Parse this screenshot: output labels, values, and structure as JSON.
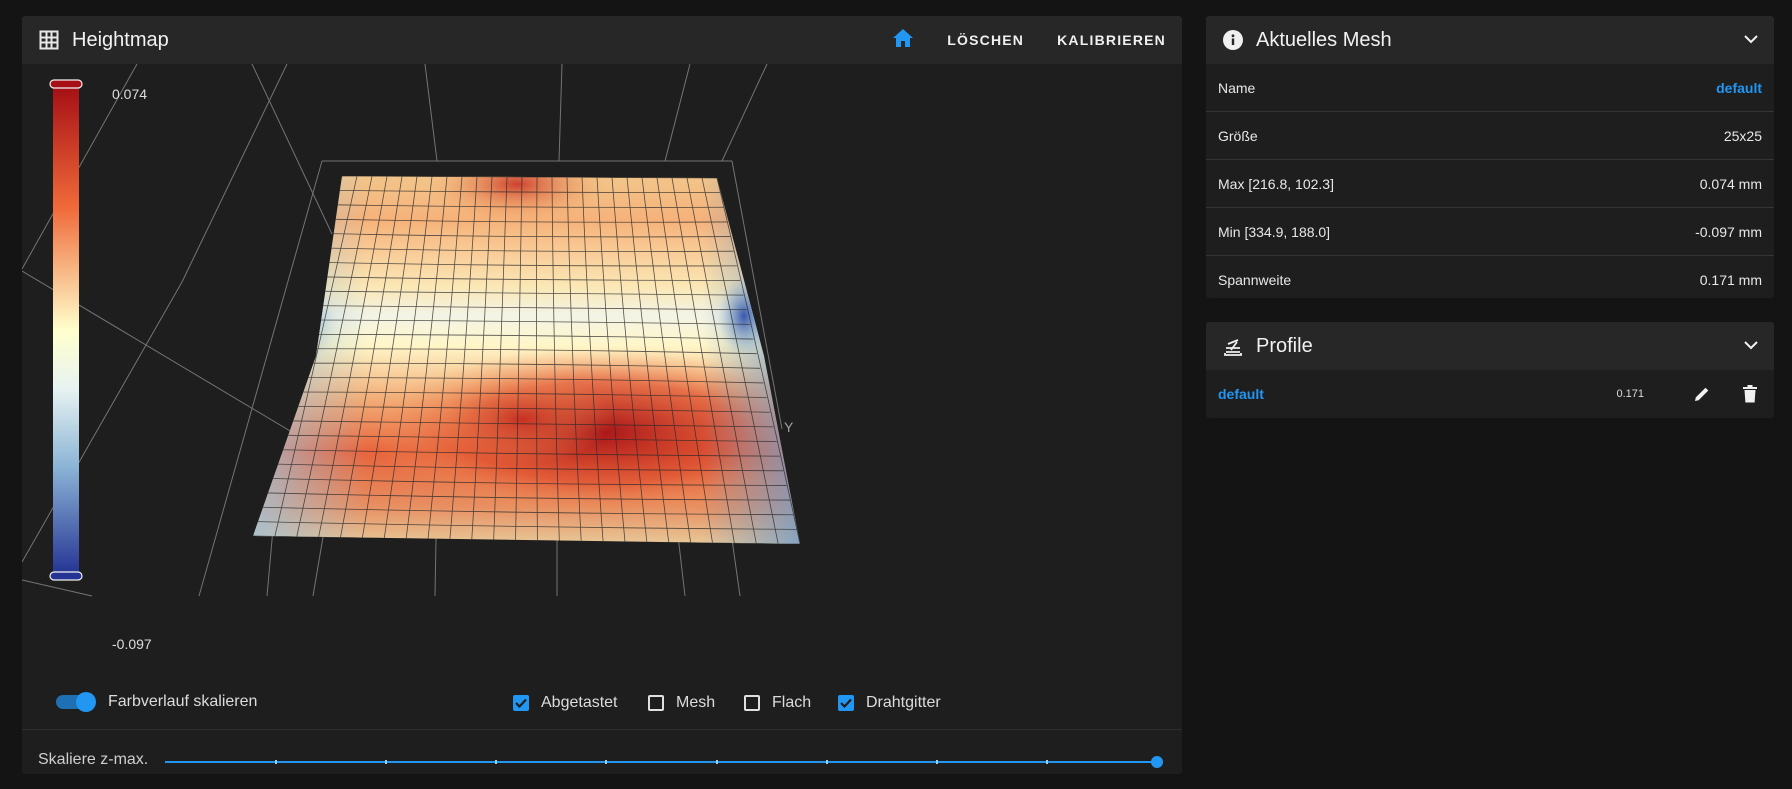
{
  "heightmap": {
    "title": "Heightmap",
    "buttons": {
      "home_icon": "home-icon",
      "clear": "LÖSCHEN",
      "calibrate": "KALIBRIEREN"
    },
    "legend": {
      "max": "0.074",
      "min": "-0.097"
    },
    "axis_label": "Y",
    "colors": {
      "high": "#a50f15",
      "mid": "#ffffcc",
      "low": "#253494"
    },
    "controls": {
      "scale_gradient": {
        "label": "Farbverlauf skalieren",
        "on": true
      },
      "checkboxes": [
        {
          "label": "Abgetastet",
          "checked": true
        },
        {
          "label": "Mesh",
          "checked": false
        },
        {
          "label": "Flach",
          "checked": false
        },
        {
          "label": "Drahtgitter",
          "checked": true
        }
      ]
    },
    "slider": {
      "label": "Skaliere z-max.",
      "value": 1.0
    }
  },
  "mesh": {
    "title": "Aktuelles Mesh",
    "rows": [
      {
        "label": "Name",
        "value": "default"
      },
      {
        "label": "Größe",
        "value": "25x25"
      },
      {
        "label": "Max [216.8, 102.3]",
        "value": "0.074 mm"
      },
      {
        "label": "Min [334.9, 188.0]",
        "value": "-0.097 mm"
      },
      {
        "label": "Spannweite",
        "value": "0.171 mm"
      }
    ]
  },
  "profiles": {
    "title": "Profile",
    "items": [
      {
        "name": "default",
        "range": "0.171"
      }
    ]
  },
  "accent_color": "#2196f3"
}
